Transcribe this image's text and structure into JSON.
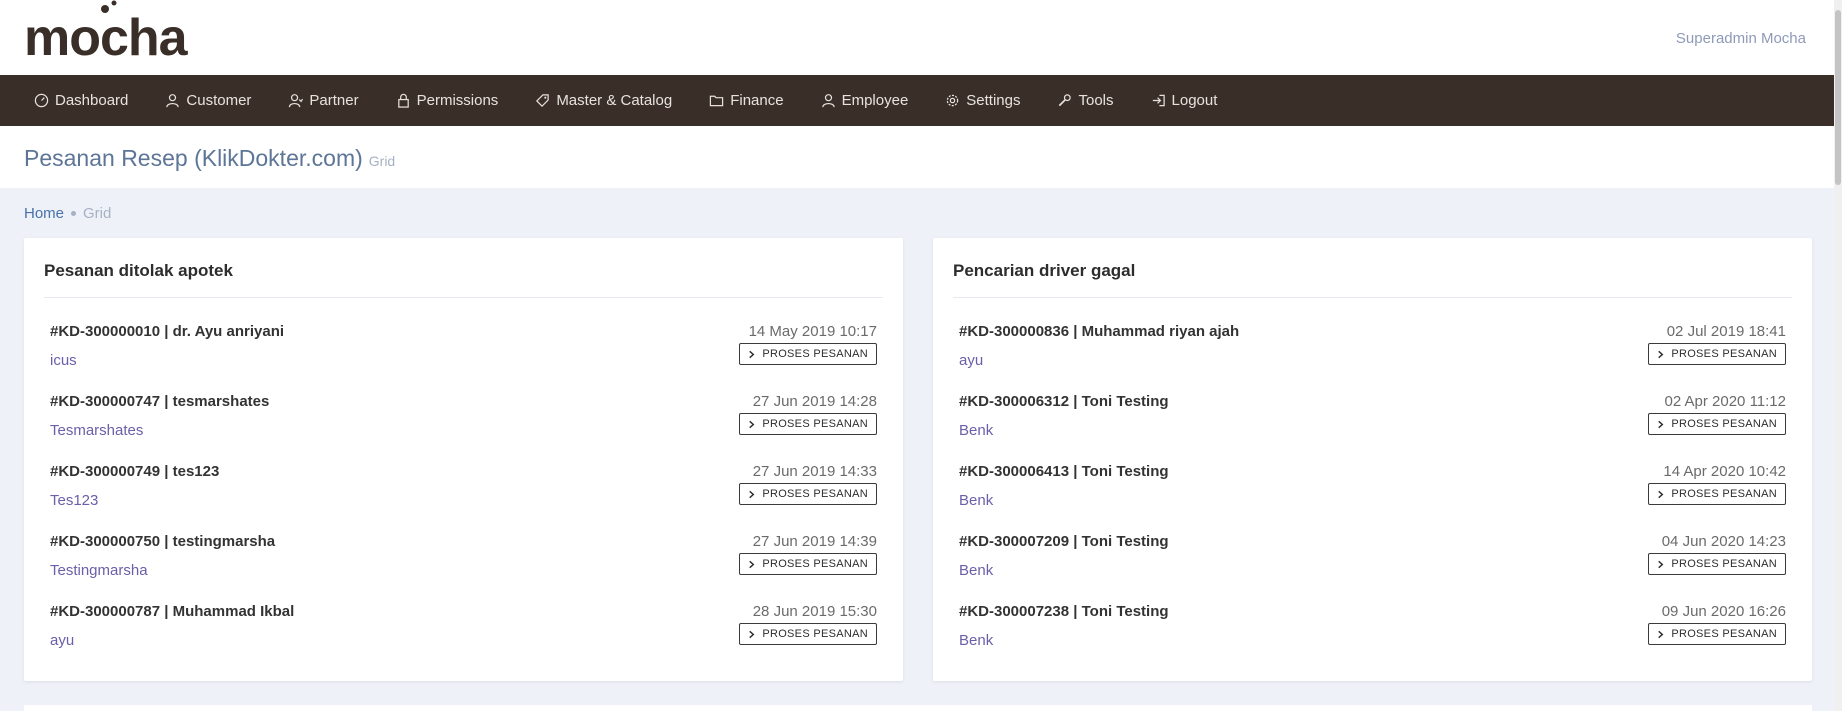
{
  "brand": {
    "logo_text": "mocha",
    "color": "#3a2f28"
  },
  "user": {
    "name": "Superadmin Mocha"
  },
  "nav": [
    {
      "label": "Dashboard",
      "icon": "dashboard-icon"
    },
    {
      "label": "Customer",
      "icon": "user-icon"
    },
    {
      "label": "Partner",
      "icon": "partner-icon"
    },
    {
      "label": "Permissions",
      "icon": "lock-icon"
    },
    {
      "label": "Master & Catalog",
      "icon": "tag-icon"
    },
    {
      "label": "Finance",
      "icon": "folder-icon"
    },
    {
      "label": "Employee",
      "icon": "user-icon"
    },
    {
      "label": "Settings",
      "icon": "gear-icon"
    },
    {
      "label": "Tools",
      "icon": "wrench-icon"
    },
    {
      "label": "Logout",
      "icon": "logout-icon"
    }
  ],
  "page": {
    "title": "Pesanan Resep (KlikDokter.com)",
    "subtitle": "Grid"
  },
  "breadcrumb": {
    "home": "Home",
    "current": "Grid"
  },
  "panels": [
    {
      "title": "Pesanan ditolak apotek",
      "orders": [
        {
          "head": "#KD-300000010 | dr. Ayu anriyani",
          "sub": "icus",
          "date": "14 May 2019 10:17",
          "button": "PROSES PESANAN"
        },
        {
          "head": "#KD-300000747 | tesmarshates",
          "sub": "Tesmarshates",
          "date": "27 Jun 2019 14:28",
          "button": "PROSES PESANAN"
        },
        {
          "head": "#KD-300000749 | tes123",
          "sub": "Tes123",
          "date": "27 Jun 2019 14:33",
          "button": "PROSES PESANAN"
        },
        {
          "head": "#KD-300000750 | testingmarsha",
          "sub": "Testingmarsha",
          "date": "27 Jun 2019 14:39",
          "button": "PROSES PESANAN"
        },
        {
          "head": "#KD-300000787 | Muhammad Ikbal",
          "sub": "ayu",
          "date": "28 Jun 2019 15:30",
          "button": "PROSES PESANAN"
        }
      ]
    },
    {
      "title": "Pencarian driver gagal",
      "orders": [
        {
          "head": "#KD-300000836 | Muhammad riyan ajah",
          "sub": "ayu",
          "date": "02 Jul 2019 18:41",
          "button": "PROSES PESANAN"
        },
        {
          "head": "#KD-300006312 | Toni Testing",
          "sub": "Benk",
          "date": "02 Apr 2020 11:12",
          "button": "PROSES PESANAN"
        },
        {
          "head": "#KD-300006413 | Toni Testing",
          "sub": "Benk",
          "date": "14 Apr 2020 10:42",
          "button": "PROSES PESANAN"
        },
        {
          "head": "#KD-300007209 | Toni Testing",
          "sub": "Benk",
          "date": "04 Jun 2020 14:23",
          "button": "PROSES PESANAN"
        },
        {
          "head": "#KD-300007238 | Toni Testing",
          "sub": "Benk",
          "date": "09 Jun 2020 16:26",
          "button": "PROSES PESANAN"
        }
      ]
    }
  ]
}
